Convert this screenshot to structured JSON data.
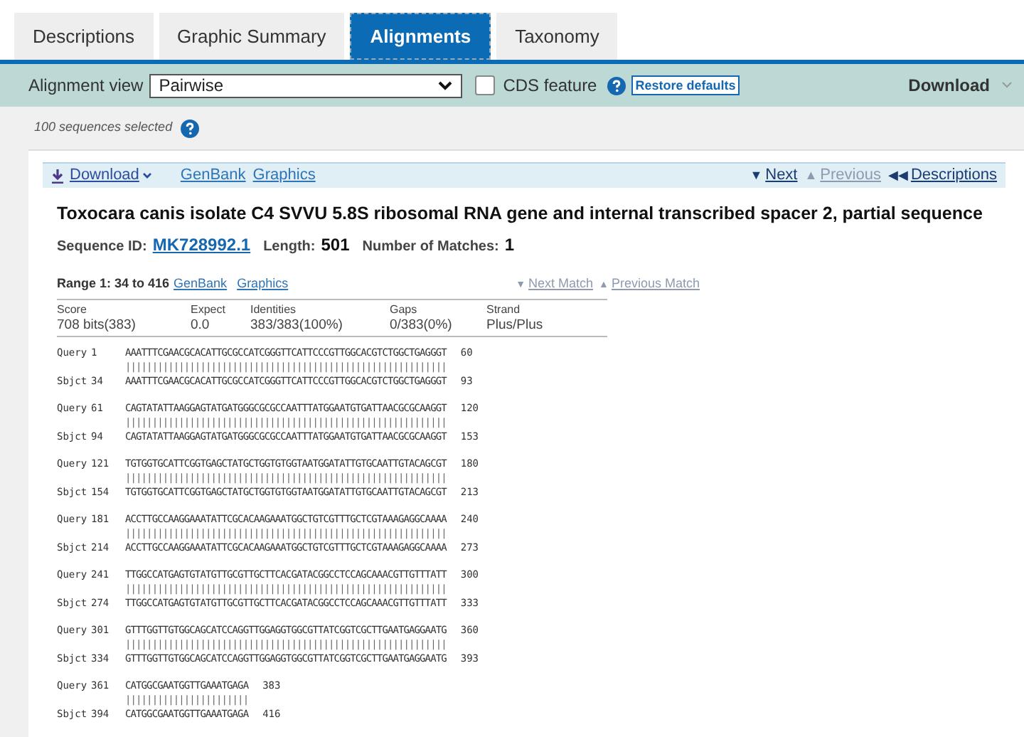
{
  "tabs": [
    {
      "label": "Descriptions",
      "selected": false
    },
    {
      "label": "Graphic Summary",
      "selected": false
    },
    {
      "label": "Alignments",
      "selected": true
    },
    {
      "label": "Taxonomy",
      "selected": false
    }
  ],
  "toolbar": {
    "view_label": "Alignment view",
    "view_value": "Pairwise",
    "cds_label": "CDS feature",
    "cds_checked": false,
    "restore_button": "Restore defaults",
    "download": "Download"
  },
  "selection_note": "100 sequences selected",
  "result": {
    "download": "Download",
    "links": [
      "GenBank",
      "Graphics"
    ],
    "nav": [
      {
        "label": "Next",
        "disabled": false,
        "arrow": "▼"
      },
      {
        "label": "Previous",
        "disabled": true,
        "arrow": "▲"
      },
      {
        "label": "Descriptions",
        "disabled": false,
        "arrow": "◀◀"
      }
    ],
    "title": "Toxocara canis isolate C4 SVVU 5.8S ribosomal RNA gene and internal transcribed spacer 2, partial sequence",
    "seq_id_label": "Sequence ID:",
    "seq_id": "MK728992.1",
    "length_label": "Length:",
    "length": "501",
    "matches_label": "Number of Matches:",
    "matches": "1",
    "range": {
      "label": "Range 1: 34 to 416",
      "links": [
        "GenBank",
        "Graphics"
      ],
      "nav": [
        {
          "label": "Next Match",
          "arrow": "▼",
          "disabled": true
        },
        {
          "label": "Previous Match",
          "arrow": "▲",
          "disabled": true
        }
      ]
    },
    "stats": {
      "columns": [
        "Score",
        "Expect",
        "Identities",
        "Gaps",
        "Strand"
      ],
      "values": [
        "708 bits(383)",
        "0.0",
        "383/383(100%)",
        "0/383(0%)",
        "Plus/Plus"
      ]
    },
    "blocks": [
      {
        "query": [
          "Query",
          "1",
          "AAATTTCGAACGCACATTGCGCCATCGGGTTCATTCCCGTTGGCACGTCTGGCTGAGGGT",
          "60"
        ],
        "match": "||||||||||||||||||||||||||||||||||||||||||||||||||||||||||||",
        "sbjct": [
          "Sbjct",
          "34",
          "AAATTTCGAACGCACATTGCGCCATCGGGTTCATTCCCGTTGGCACGTCTGGCTGAGGGT",
          "93"
        ]
      },
      {
        "query": [
          "Query",
          "61",
          "CAGTATATTAAGGAGTATGATGGGCGCGCCAATTTATGGAATGTGATTAACGCGCAAGGT",
          "120"
        ],
        "match": "||||||||||||||||||||||||||||||||||||||||||||||||||||||||||||",
        "sbjct": [
          "Sbjct",
          "94",
          "CAGTATATTAAGGAGTATGATGGGCGCGCCAATTTATGGAATGTGATTAACGCGCAAGGT",
          "153"
        ]
      },
      {
        "query": [
          "Query",
          "121",
          "TGTGGTGCATTCGGTGAGCTATGCTGGTGTGGTAATGGATATTGTGCAATTGTACAGCGT",
          "180"
        ],
        "match": "||||||||||||||||||||||||||||||||||||||||||||||||||||||||||||",
        "sbjct": [
          "Sbjct",
          "154",
          "TGTGGTGCATTCGGTGAGCTATGCTGGTGTGGTAATGGATATTGTGCAATTGTACAGCGT",
          "213"
        ]
      },
      {
        "query": [
          "Query",
          "181",
          "ACCTTGCCAAGGAAATATTCGCACAAGAAATGGCTGTCGTTTGCTCGTAAAGAGGCAAAA",
          "240"
        ],
        "match": "||||||||||||||||||||||||||||||||||||||||||||||||||||||||||||",
        "sbjct": [
          "Sbjct",
          "214",
          "ACCTTGCCAAGGAAATATTCGCACAAGAAATGGCTGTCGTTTGCTCGTAAAGAGGCAAAA",
          "273"
        ]
      },
      {
        "query": [
          "Query",
          "241",
          "TTGGCCATGAGTGTATGTTGCGTTGCTTCACGATACGGCCTCCAGCAAACGTTGTTTATT",
          "300"
        ],
        "match": "||||||||||||||||||||||||||||||||||||||||||||||||||||||||||||",
        "sbjct": [
          "Sbjct",
          "274",
          "TTGGCCATGAGTGTATGTTGCGTTGCTTCACGATACGGCCTCCAGCAAACGTTGTTTATT",
          "333"
        ]
      },
      {
        "query": [
          "Query",
          "301",
          "GTTTGGTTGTGGCAGCATCCAGGTTGGAGGTGGCGTTATCGGTCGCTTGAATGAGGAATG",
          "360"
        ],
        "match": "||||||||||||||||||||||||||||||||||||||||||||||||||||||||||||",
        "sbjct": [
          "Sbjct",
          "334",
          "GTTTGGTTGTGGCAGCATCCAGGTTGGAGGTGGCGTTATCGGTCGCTTGAATGAGGAATG",
          "393"
        ]
      },
      {
        "query": [
          "Query",
          "361",
          "CATGGCGAATGGTTGAAATGAGA",
          "383"
        ],
        "match": "|||||||||||||||||||||||",
        "sbjct": [
          "Sbjct",
          "394",
          "CATGGCGAATGGTTGAAATGAGA",
          "416"
        ]
      }
    ]
  }
}
